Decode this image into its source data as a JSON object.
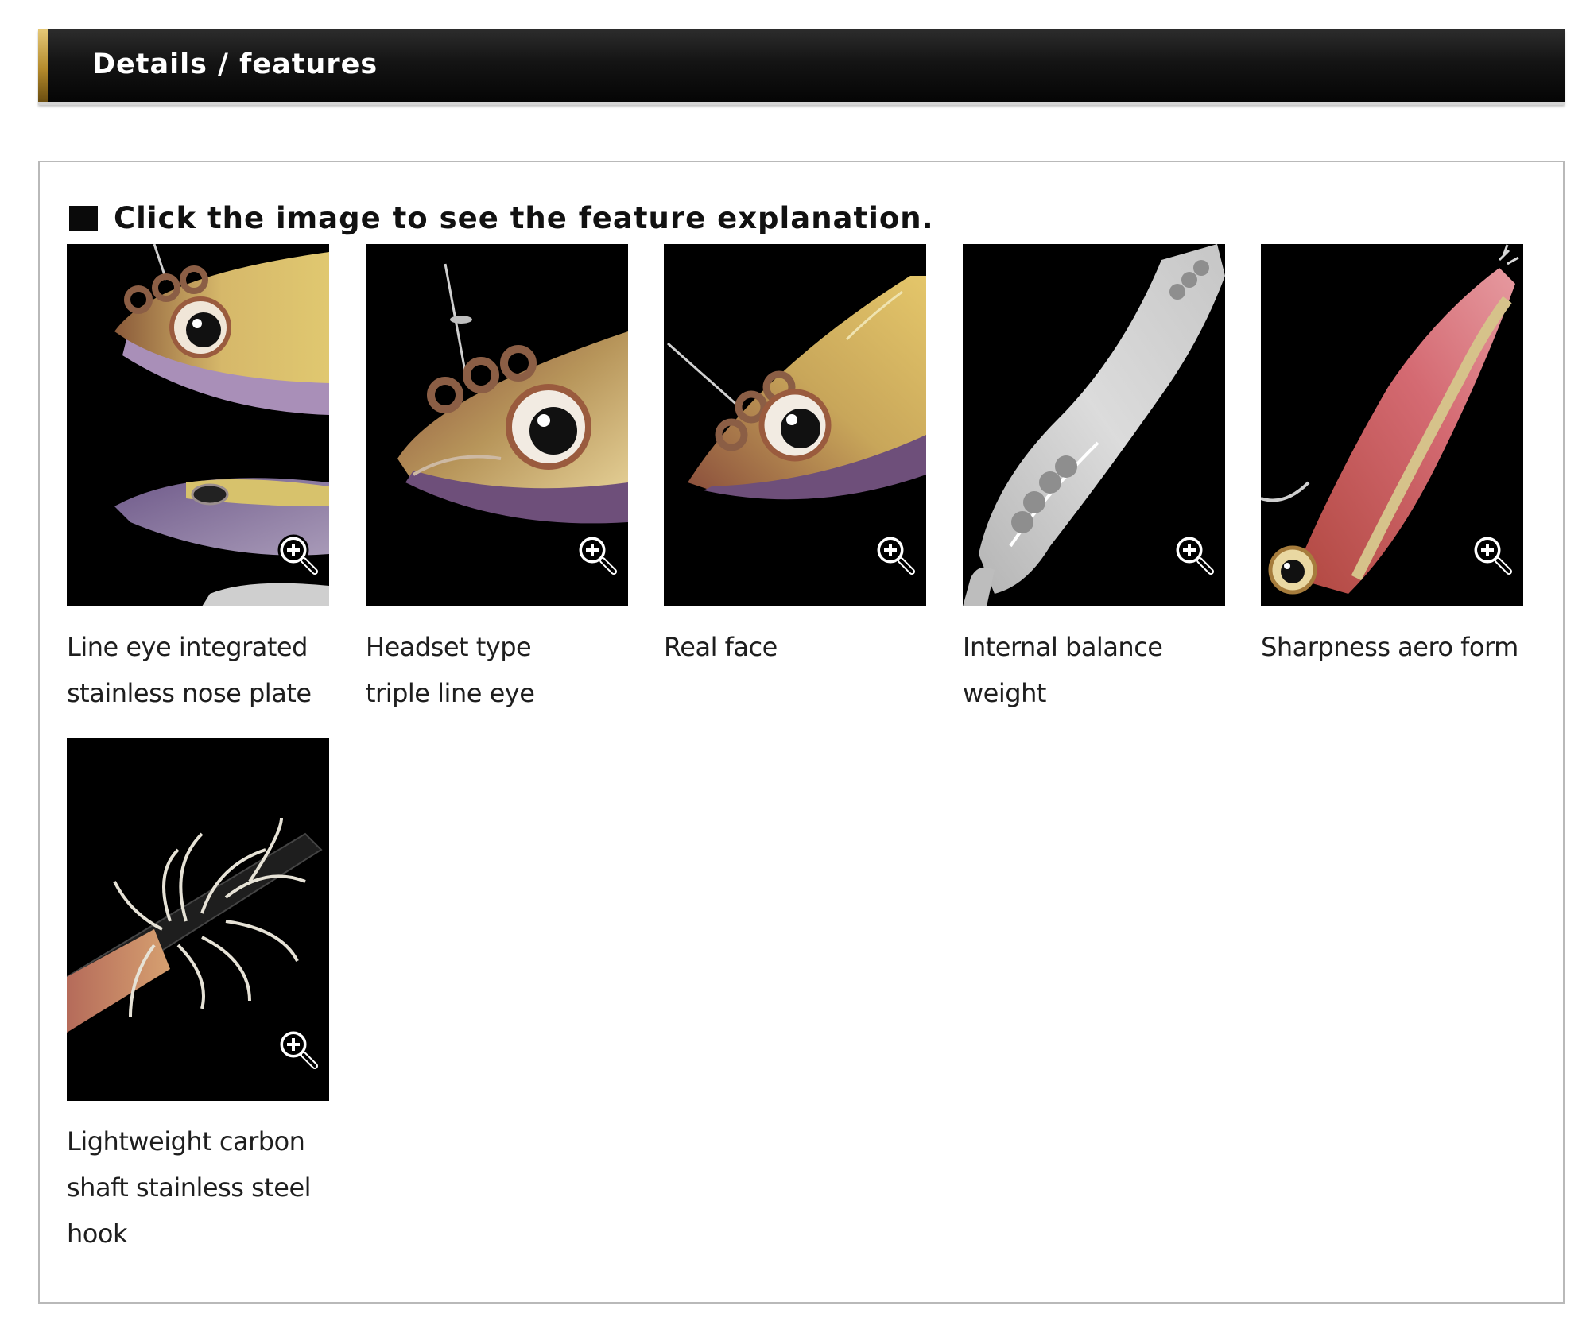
{
  "header": {
    "title": "Details / features"
  },
  "panel": {
    "instruction": "Click the image to see the feature explanation."
  },
  "features": [
    {
      "caption_line1": "Line eye integrated",
      "caption_line2": "stainless nose plate",
      "caption_line3": "",
      "icon": "zoom-in-icon"
    },
    {
      "caption_line1": "Headset type",
      "caption_line2": "triple line eye",
      "caption_line3": "",
      "icon": "zoom-in-icon"
    },
    {
      "caption_line1": "Real face",
      "caption_line2": "",
      "caption_line3": "",
      "icon": "zoom-in-icon"
    },
    {
      "caption_line1": "Internal balance",
      "caption_line2": "weight",
      "caption_line3": "",
      "icon": "zoom-in-icon"
    },
    {
      "caption_line1": "Sharpness aero form",
      "caption_line2": "",
      "caption_line3": "",
      "icon": "zoom-in-icon"
    },
    {
      "caption_line1": "Lightweight carbon",
      "caption_line2": "shaft stainless steel",
      "caption_line3": "hook",
      "icon": "zoom-in-icon"
    }
  ],
  "colors": {
    "header_bg": "#0a0a0a",
    "header_accent": "#c9a24a",
    "thumb_bg": "#000000",
    "panel_border": "#b9b9b9"
  }
}
